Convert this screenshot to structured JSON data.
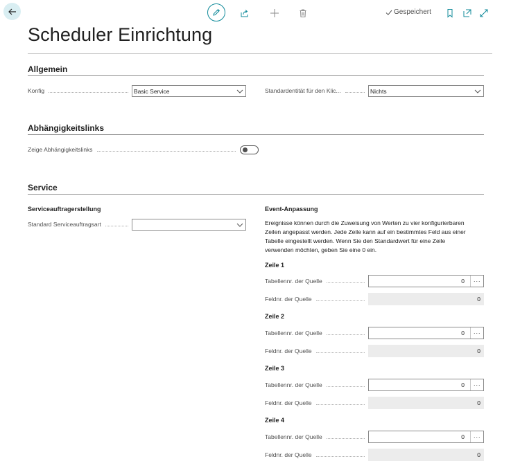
{
  "toolbar": {
    "saved_label": "Gespeichert"
  },
  "page": {
    "title": "Scheduler Einrichtung"
  },
  "sections": {
    "general": {
      "title": "Allgemein",
      "konfig_label": "Konfig",
      "konfig_value": "Basic Service",
      "standard_entity_label": "Standardentität für den Klic...",
      "standard_entity_value": "Nichts"
    },
    "dependencies": {
      "title": "Abhängigkeitslinks",
      "show_label": "Zeige Abhängigkeitslinks",
      "show_value": false
    },
    "service": {
      "title": "Service",
      "order_creation_title": "Serviceauftragerstellung",
      "order_type_label": "Standard Serviceauftragsart",
      "order_type_value": "",
      "event_title": "Event-Anpassung",
      "event_desc": "Ereignisse können durch die Zuweisung von Werten zu vier konfigurierbaren Zeilen angepasst werden. Jede Zeile kann auf ein bestimmtes Feld aus einer Tabelle eingestellt werden. Wenn Sie den Standardwert für eine Zeile verwenden möchten, geben Sie eine 0 ein.",
      "lines": [
        {
          "title": "Zeile 1",
          "table_label": "Tabellennr. der Quelle",
          "table_value": "0",
          "field_label": "Feldnr. der Quelle",
          "field_value": "0"
        },
        {
          "title": "Zeile 2",
          "table_label": "Tabellennr. der Quelle",
          "table_value": "0",
          "field_label": "Feldnr. der Quelle",
          "field_value": "0"
        },
        {
          "title": "Zeile 3",
          "table_label": "Tabellennr. der Quelle",
          "table_value": "0",
          "field_label": "Feldnr. der Quelle",
          "field_value": "0"
        },
        {
          "title": "Zeile 4",
          "table_label": "Tabellennr. der Quelle",
          "table_value": "0",
          "field_label": "Feldnr. der Quelle",
          "field_value": "0"
        }
      ]
    }
  },
  "colors": {
    "accent": "#0f8a9a",
    "back_bg": "#d9eef2"
  }
}
